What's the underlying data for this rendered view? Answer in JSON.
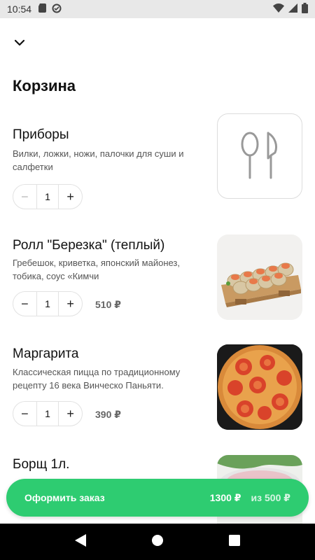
{
  "status_bar": {
    "time": "10:54"
  },
  "page": {
    "title": "Корзина"
  },
  "items": [
    {
      "name": "Приборы",
      "description": "Вилки, ложки, ножи, палочки для суши и салфетки",
      "quantity": "1",
      "price": "",
      "icon": "cutlery-icon"
    },
    {
      "name": "Ролл \"Березка\" (теплый)",
      "description": "Гребешок, криветка, японский майонез, тобика, соус «Кимчи",
      "quantity": "1",
      "price": "510 ₽"
    },
    {
      "name": "Маргарита",
      "description": "Классическая пицца по традиционному рецепту 16 века Винческо Паньяти.",
      "quantity": "1",
      "price": "390 ₽"
    },
    {
      "name": "Борщ 1л.",
      "description": "",
      "quantity": "",
      "price": ""
    }
  ],
  "order_bar": {
    "label": "Оформить заказ",
    "total": "1300 ₽",
    "minimum": "из 500 ₽"
  },
  "colors": {
    "accent": "#2ecc71",
    "status_bar_bg": "#e8e8e8",
    "nav_bar_bg": "#000000"
  }
}
